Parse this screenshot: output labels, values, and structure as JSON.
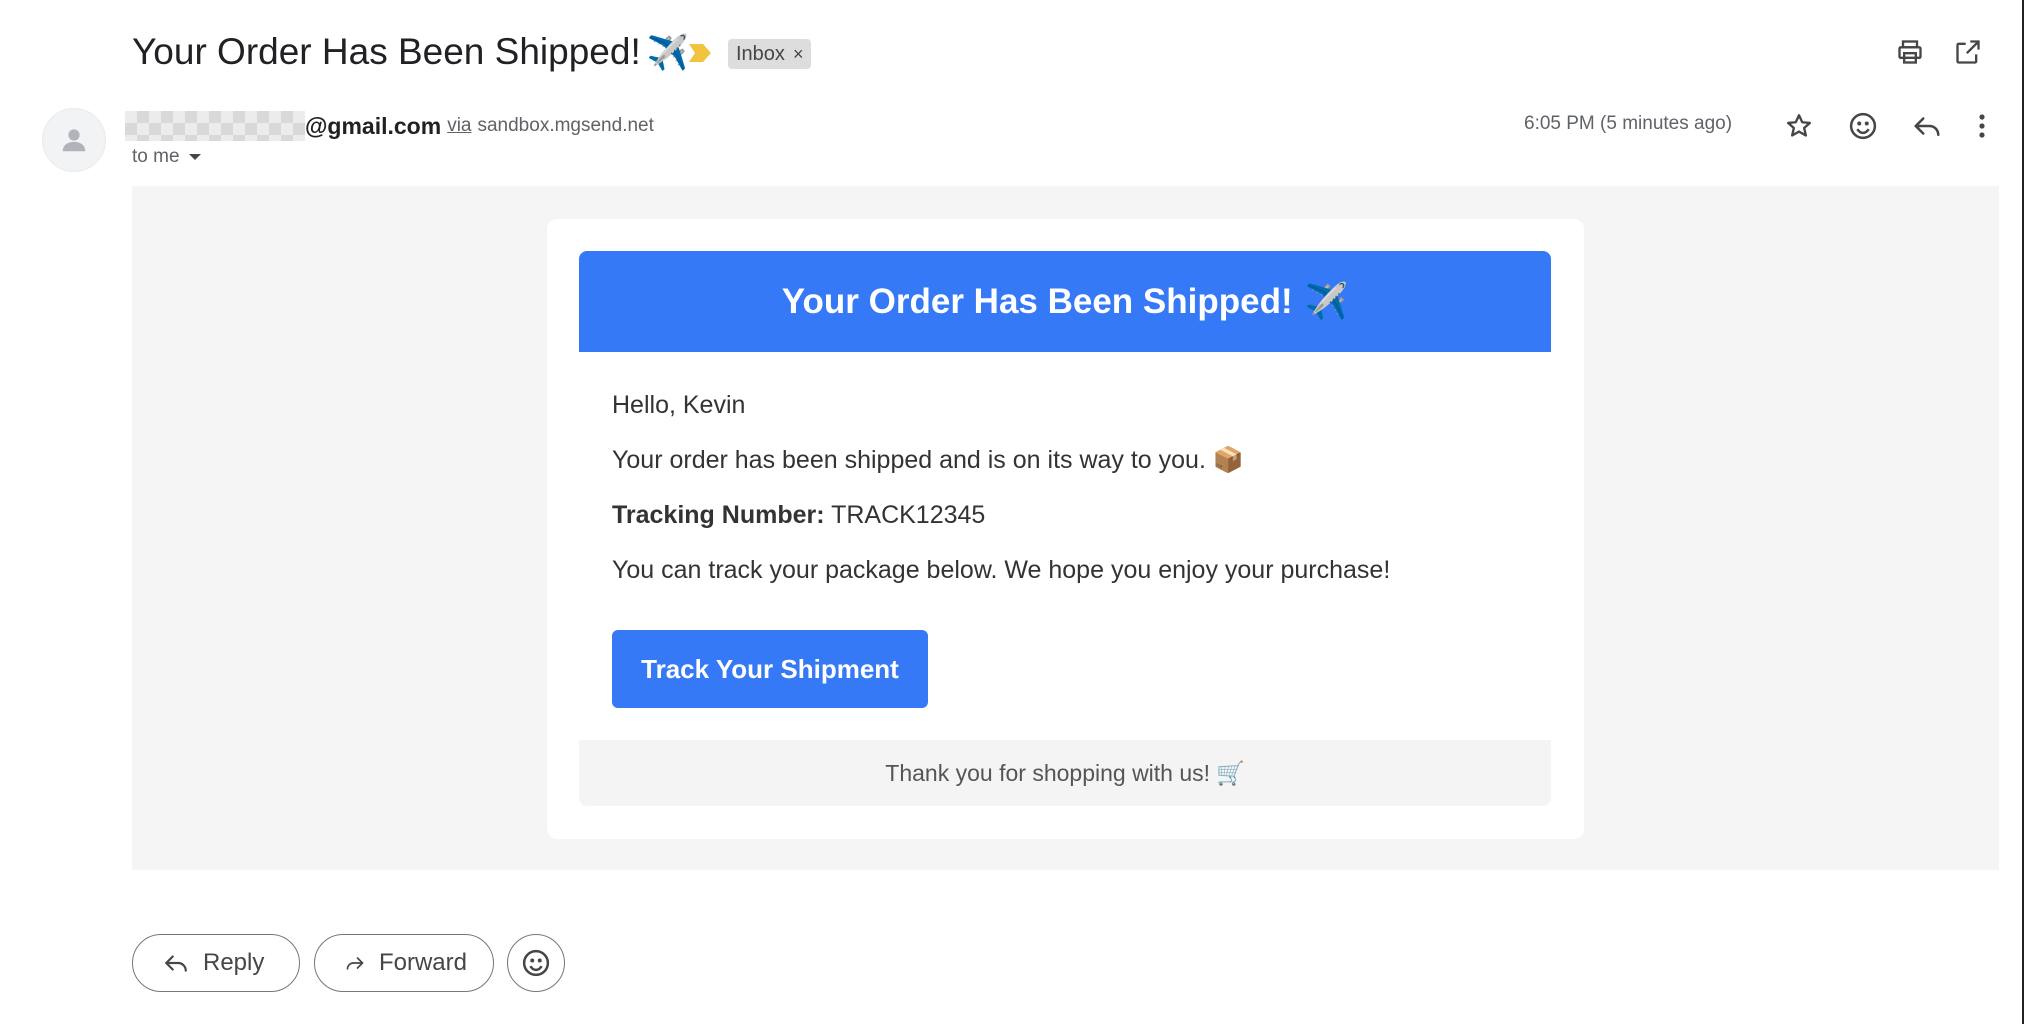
{
  "email": {
    "subject": "Your Order Has Been Shipped!",
    "subject_emoji": "✈️",
    "label": "Inbox",
    "sender_domain": "@gmail.com",
    "via_text": "via",
    "via_domain": "sandbox.mgsend.net",
    "recipient": "to me",
    "time": "6:05 PM (5 minutes ago)"
  },
  "message": {
    "banner_title": "Your Order Has Been Shipped!",
    "banner_emoji": "✈️",
    "greeting": "Hello, Kevin",
    "line1": "Your order has been shipped and is on its way to you.",
    "line1_emoji": "📦",
    "tracking_label": "Tracking Number:",
    "tracking_value": "TRACK12345",
    "line3": "You can track your package below. We hope you enjoy your purchase!",
    "button_label": "Track Your Shipment",
    "footer_text": "Thank you for shopping with us!",
    "footer_emoji": "🛒"
  },
  "actions": {
    "reply": "Reply",
    "forward": "Forward"
  },
  "colors": {
    "accent": "#3579f6",
    "importance_marker": "#f2c341",
    "body_background": "#f5f5f5"
  },
  "icons": [
    "print-icon",
    "open-in-new-icon",
    "star-icon",
    "emoji-icon",
    "reply-icon",
    "more-vert-icon",
    "forward-icon",
    "importance-marker-icon",
    "avatar-person-icon",
    "caret-down-icon"
  ]
}
